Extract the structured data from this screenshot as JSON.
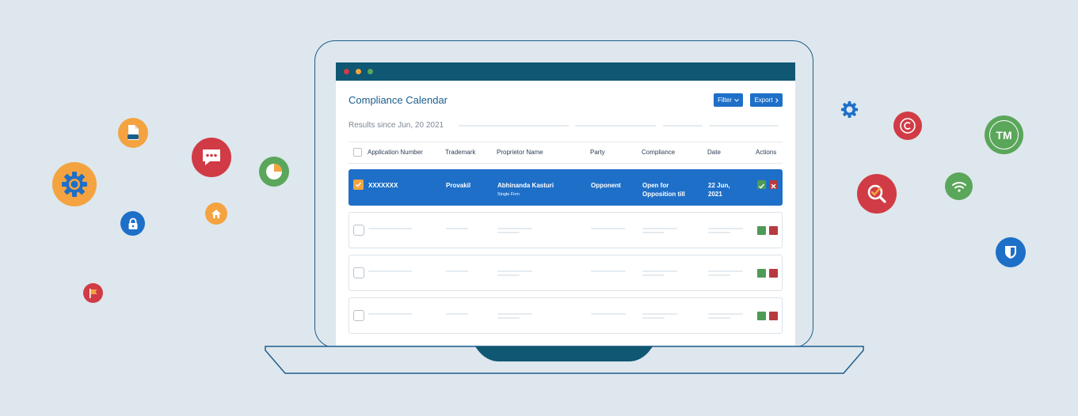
{
  "app": {
    "title": "Compliance Calendar",
    "filter_label": "Filter",
    "export_label": "Export",
    "results_text": "Results since Jun, 20 2021"
  },
  "table": {
    "columns": [
      "Application Number",
      "Trademark",
      "Proprietor Name",
      "Party",
      "Compliance",
      "Date",
      "Actions"
    ],
    "selected_row": {
      "application_number": "XXXXXXX",
      "trademark": "Provakil",
      "proprietor_name": "Abhinanda Kasturi",
      "proprietor_type": "Single Firm",
      "party": "Opponent",
      "compliance_line1": "Open for",
      "compliance_line2": "Opposition till",
      "date_line1": "22 Jun,",
      "date_line2": "2021"
    },
    "placeholder_row_count": 3
  },
  "badges": {
    "trademark_badge": "TM"
  },
  "colors": {
    "titlebar": "#0f5772",
    "accent_blue": "#1e6fc8",
    "approve_green": "#4f9a57",
    "reject_red": "#b73a3f",
    "icon_orange": "#f4a340",
    "icon_red": "#d13b45",
    "icon_green": "#5aa65a",
    "icon_blue": "#1e6fc8"
  },
  "icons": [
    "document-icon",
    "gear-icon",
    "chat-icon",
    "lock-icon",
    "home-icon",
    "pie-chart-icon",
    "flag-icon",
    "settings-icon",
    "copyright-icon",
    "trademark-icon",
    "search-check-icon",
    "wifi-icon",
    "shield-icon",
    "check-icon",
    "close-icon",
    "chevron-down-icon",
    "chevron-right-icon"
  ]
}
